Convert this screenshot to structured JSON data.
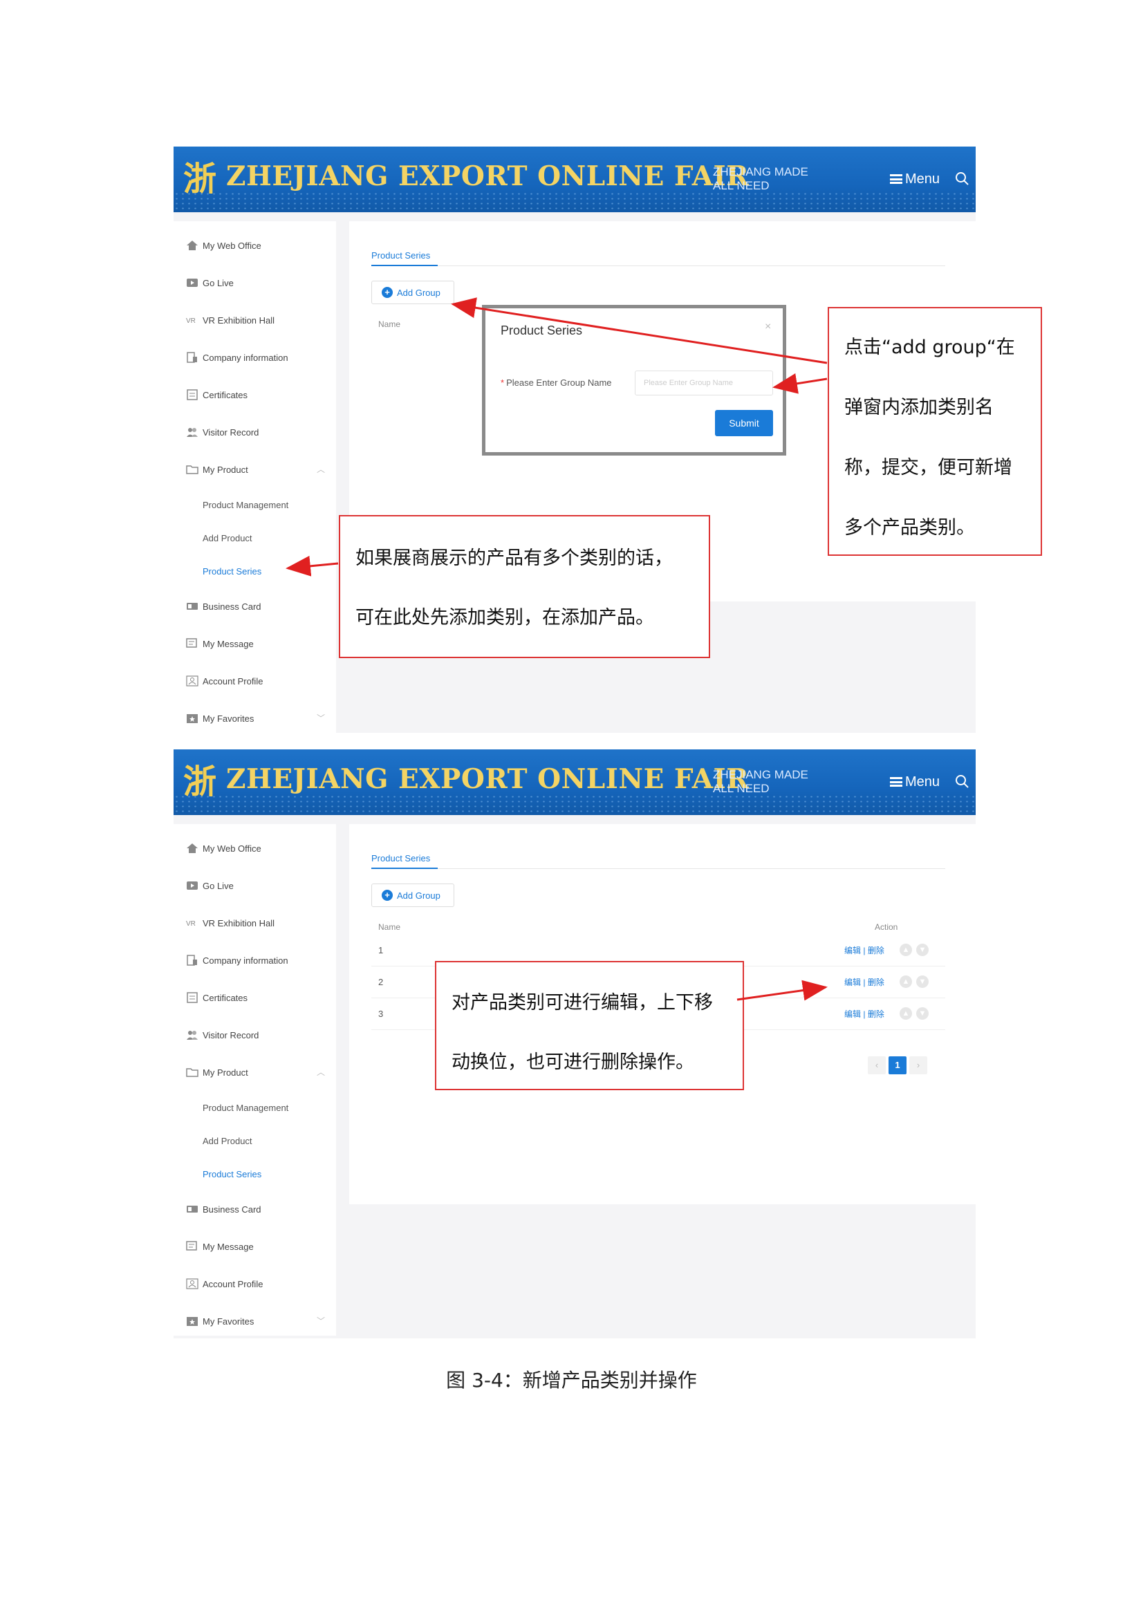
{
  "banner": {
    "logo_glyph": "浙",
    "title": "ZHEJIANG EXPORT ONLINE FAIR",
    "tagline": "ZHEJIANG MADE\nALL NEED",
    "menu_label": "Menu"
  },
  "sidebar": {
    "items": [
      {
        "label": "My Web Office",
        "icon": "home-icon"
      },
      {
        "label": "Go Live",
        "icon": "video-icon"
      },
      {
        "label": "VR Exhibition Hall",
        "icon": "vr-icon"
      },
      {
        "label": "Company information",
        "icon": "building-icon"
      },
      {
        "label": "Certificates",
        "icon": "certificate-icon"
      },
      {
        "label": "Visitor Record",
        "icon": "users-icon"
      },
      {
        "label": "My Product",
        "icon": "folder-icon"
      },
      {
        "label": "Product Management"
      },
      {
        "label": "Add Product"
      },
      {
        "label": "Product Series"
      },
      {
        "label": "Business Card",
        "icon": "card-icon"
      },
      {
        "label": "My Message",
        "icon": "message-icon"
      },
      {
        "label": "Account Profile",
        "icon": "profile-icon"
      },
      {
        "label": "My Favorites",
        "icon": "star-folder-icon"
      }
    ]
  },
  "content": {
    "tab_title": "Product Series",
    "add_group_label": "Add Group",
    "col_name": "Name",
    "col_action": "Action"
  },
  "modal": {
    "title": "Product Series",
    "close": "×",
    "field_required_mark": "*",
    "field_label": "Please Enter Group Name",
    "field_placeholder": "Please Enter Group Name",
    "submit_label": "Submit"
  },
  "table": {
    "rows": [
      {
        "num": "1",
        "edit": "编辑",
        "sep": " | ",
        "delete": "删除"
      },
      {
        "num": "2",
        "edit": "编辑",
        "sep": " | ",
        "delete": "删除"
      },
      {
        "num": "3",
        "edit": "编辑",
        "sep": " | ",
        "delete": "删除"
      }
    ],
    "pager": {
      "prev": "‹",
      "current": "1",
      "next": "›"
    }
  },
  "callouts": {
    "add_group": [
      "点击“add group“在",
      "弹窗内添加类别名",
      "称，提交，便可新增",
      "多个产品类别。"
    ],
    "product_series": [
      "如果展商展示的产品有多个类别的话，",
      "可在此处先添加类别，在添加产品。"
    ],
    "edit_move": [
      "对产品类别可进行编辑，上下移",
      "动换位，也可进行删除操作。"
    ]
  },
  "caption": "图 3-4：新增产品类别并操作",
  "colors": {
    "banner": "#1565bb",
    "title_gold": "#f4d464",
    "accent": "#1a7bd8",
    "callout_border": "#d33"
  }
}
